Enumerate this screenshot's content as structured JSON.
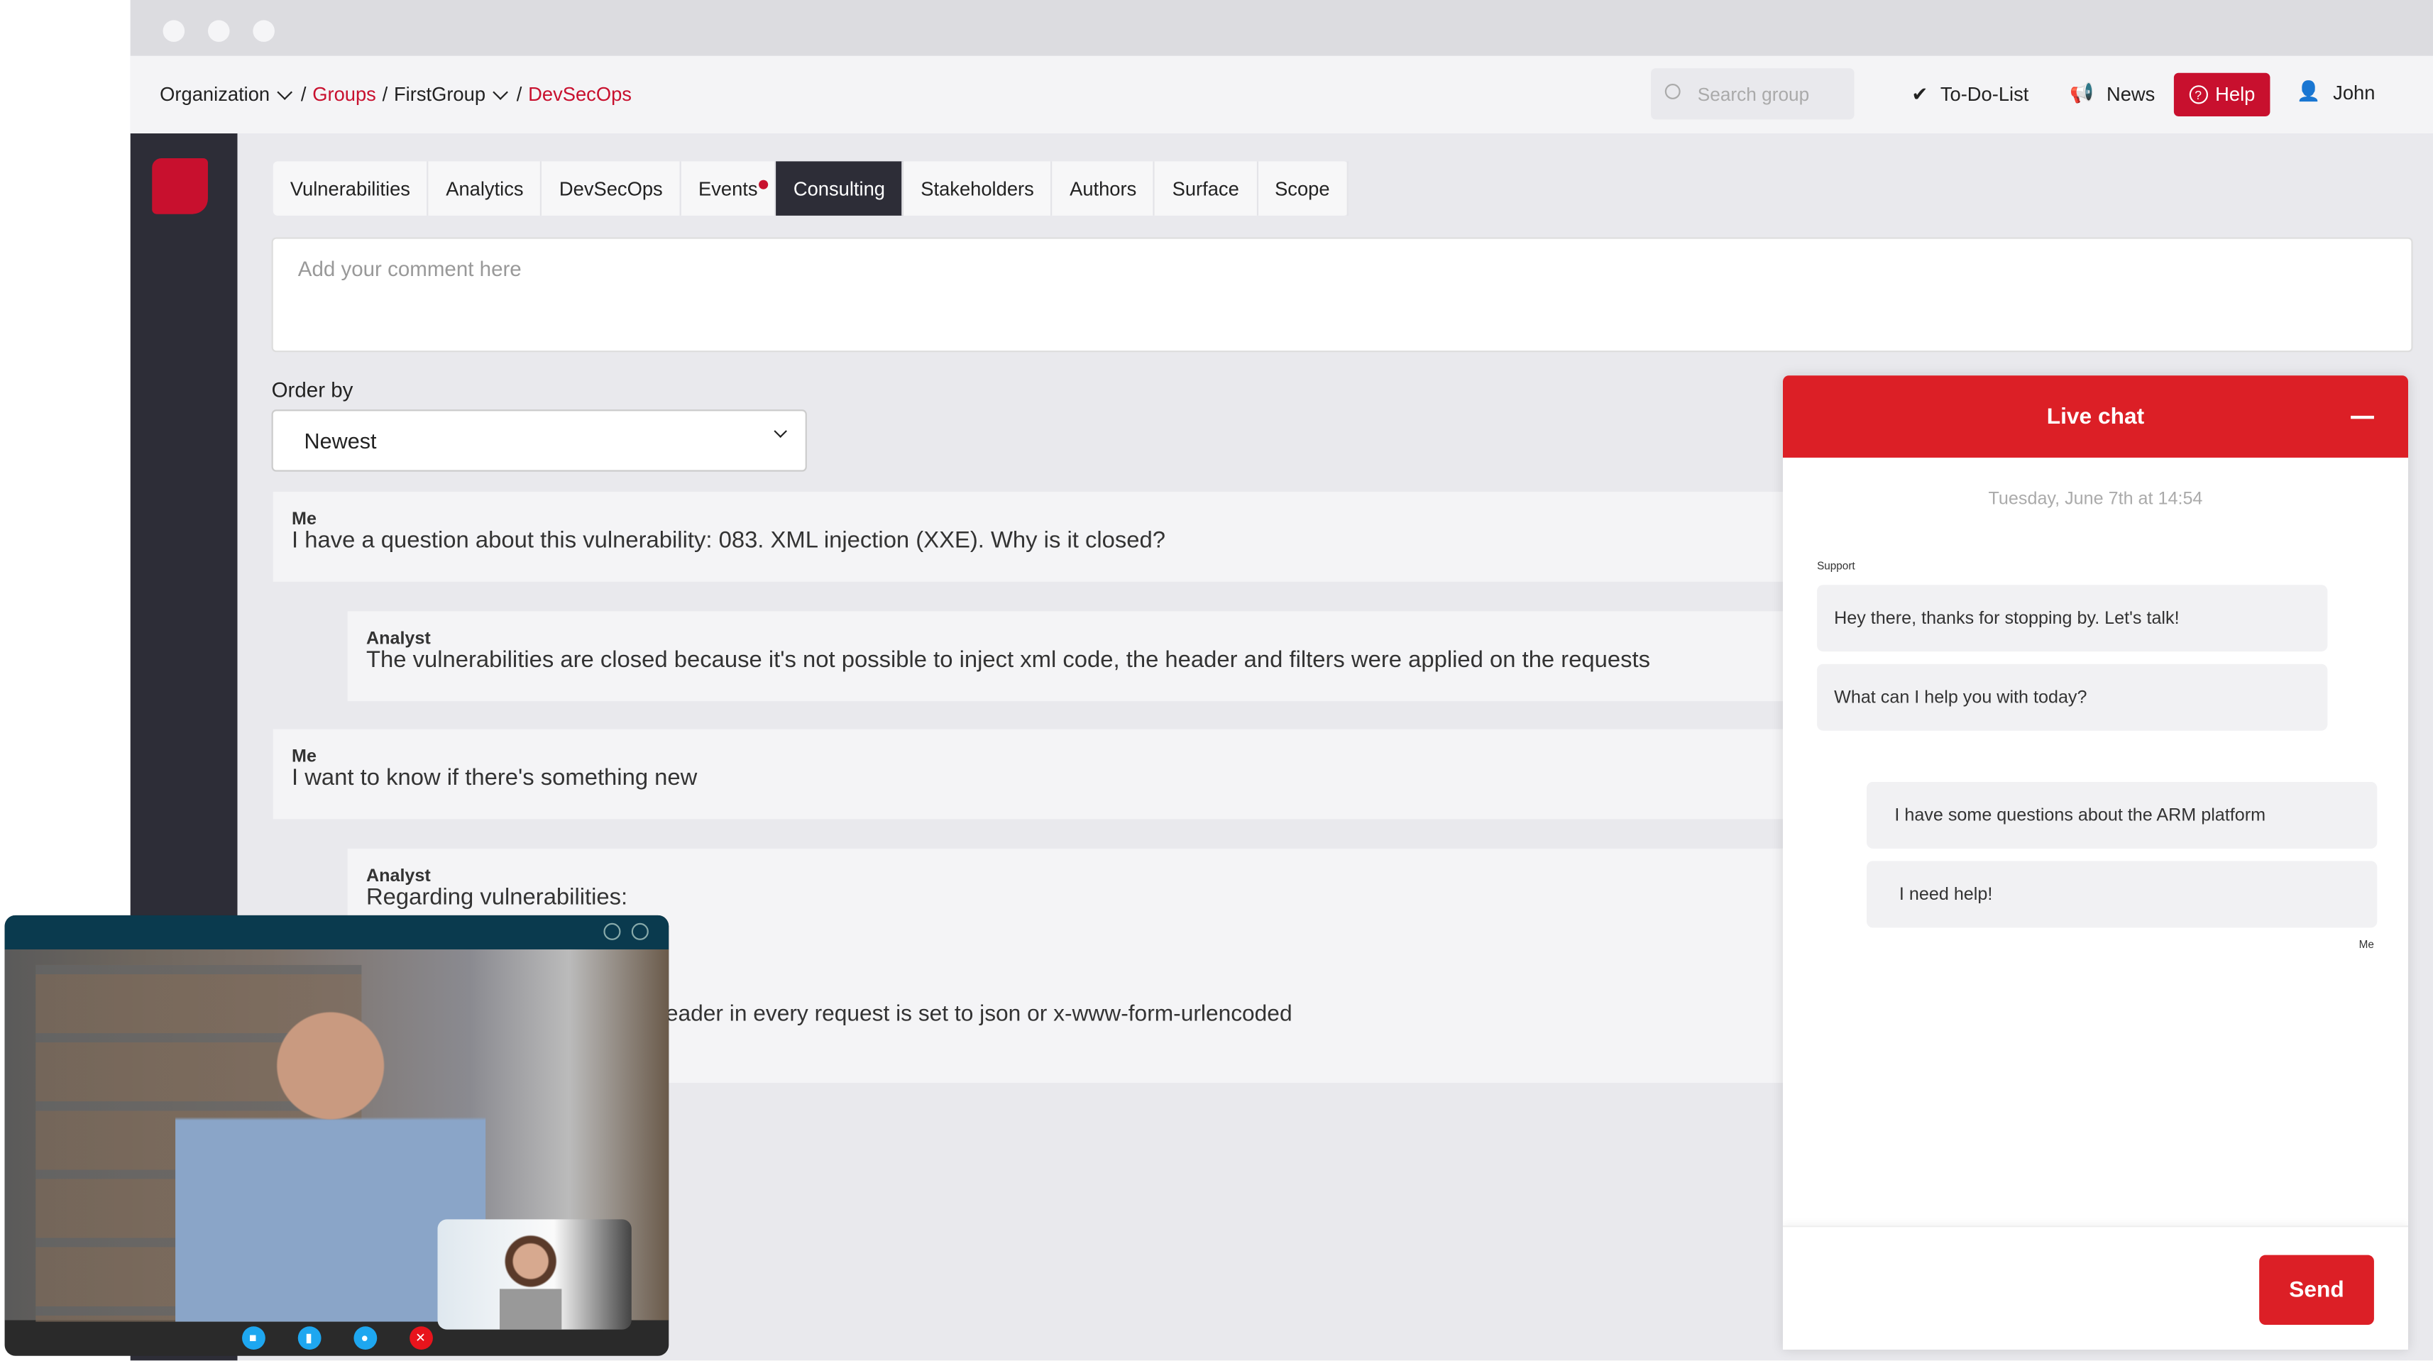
{
  "breadcrumb": {
    "org": "Organization",
    "sep": "/",
    "groups": "Groups",
    "group": "FirstGroup",
    "current": "DevSecOps"
  },
  "topbar": {
    "search_placeholder": "Search group",
    "todo": "To-Do-List",
    "news": "News",
    "help": "Help",
    "user": "John"
  },
  "tabs": [
    {
      "label": "Vulnerabilities"
    },
    {
      "label": "Analytics"
    },
    {
      "label": "DevSecOps"
    },
    {
      "label": "Events",
      "badge": true
    },
    {
      "label": "Consulting",
      "active": true
    },
    {
      "label": "Stakeholders"
    },
    {
      "label": "Authors"
    },
    {
      "label": "Surface"
    },
    {
      "label": "Scope"
    }
  ],
  "comment": {
    "placeholder": "Add your comment here"
  },
  "order": {
    "label": "Order by",
    "value": "Newest"
  },
  "messages": [
    {
      "author": "Me",
      "text": "I have a question about this vulnerability: 083. XML injection (XXE). Why is it closed?"
    },
    {
      "author": "Analyst",
      "text": "The vulnerabilities are closed because it's not possible to inject xml code, the header and filters were applied on the requests"
    },
    {
      "author": "Me",
      "text": "I want to know if there's something new"
    },
    {
      "author": "Analyst",
      "text": "Regarding vulnerabilities:",
      "text2": "eader  in every request is set to json or x-www-form-urlencoded"
    }
  ],
  "chat": {
    "title": "Live chat",
    "date": "Tuesday, June 7th at 14:54",
    "support_label": "Support",
    "me_label": "Me",
    "support_msgs": [
      "Hey there, thanks for stopping by. Let's talk!",
      "What can I help you with today?"
    ],
    "my_msgs": [
      "I have some questions about the ARM platform",
      "I need help!"
    ],
    "send": "Send"
  },
  "colors": {
    "accent": "#c8102e",
    "chat_header": "#dc1f26",
    "sidebar": "#2d2d37",
    "video_header": "#0a3a4e"
  }
}
